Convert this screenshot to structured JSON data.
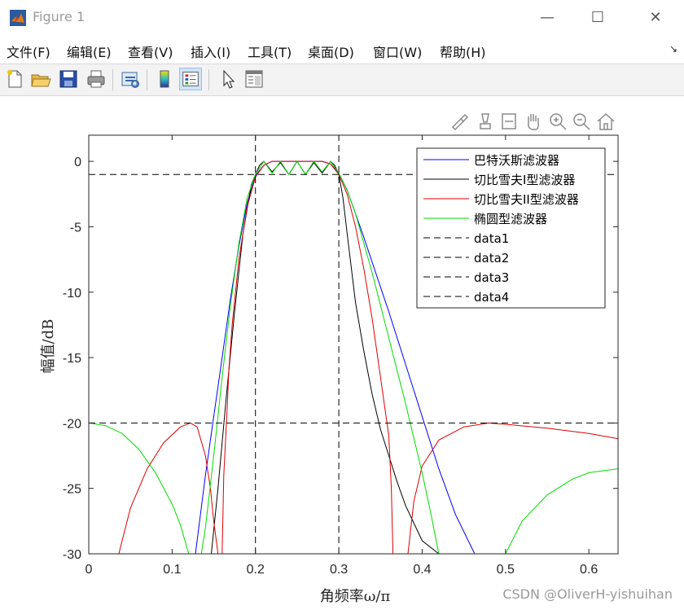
{
  "window": {
    "title": "Figure 1",
    "minimize": "—",
    "maximize": "☐",
    "close": "✕"
  },
  "menu": [
    "文件(F)",
    "编辑(E)",
    "查看(V)",
    "插入(I)",
    "工具(T)",
    "桌面(D)",
    "窗口(W)",
    "帮助(H)"
  ],
  "toolbar": {
    "buttons": [
      "new-figure-icon",
      "open-file-icon",
      "save-icon",
      "print-icon",
      "link-plot-icon",
      "colorbar-icon",
      "legend-icon",
      "pointer-icon",
      "property-inspector-icon"
    ]
  },
  "axes_toolbar": [
    "brush-icon",
    "data-tips-icon",
    "restore-view-icon",
    "pan-icon",
    "zoom-in-icon",
    "zoom-out-icon",
    "home-icon"
  ],
  "watermark": "CSDN @OliverH-yishuihan",
  "chart_data": {
    "type": "line",
    "title": "",
    "xlabel": "角频率ω/π",
    "ylabel": "幅值/dB",
    "xlim": [
      0,
      0.635
    ],
    "ylim": [
      -30,
      2
    ],
    "xticks": [
      0,
      0.1,
      0.2,
      0.3,
      0.4,
      0.5,
      0.6
    ],
    "xtick_labels": [
      "0",
      "0.1",
      "0.2",
      "0.3",
      "0.4",
      "0.5",
      "0.6"
    ],
    "yticks": [
      0,
      -5,
      -10,
      -15,
      -20,
      -25,
      -30
    ],
    "ytick_labels": [
      "0",
      "-5",
      "-10",
      "-15",
      "-20",
      "-25",
      "-30"
    ],
    "grid": false,
    "legend_position": "top-right",
    "series": [
      {
        "name": "巴特沃斯滤波器",
        "color": "#0000ff",
        "style": "solid",
        "x": [
          0.128,
          0.14,
          0.15,
          0.16,
          0.17,
          0.18,
          0.19,
          0.2,
          0.21,
          0.22,
          0.25,
          0.28,
          0.29,
          0.3,
          0.31,
          0.32,
          0.33,
          0.34,
          0.36,
          0.38,
          0.4,
          0.42,
          0.44,
          0.463
        ],
        "y": [
          -30,
          -24,
          -19.5,
          -15,
          -10.5,
          -6.5,
          -3.2,
          -1.1,
          -0.3,
          0,
          0,
          0,
          -0.2,
          -0.9,
          -2.2,
          -4,
          -5.8,
          -7.7,
          -11.5,
          -15.5,
          -19.5,
          -23.5,
          -27,
          -30
        ]
      },
      {
        "name": "切比雪夫I型滤波器",
        "color": "#000000",
        "style": "solid",
        "x": [
          0.147,
          0.155,
          0.165,
          0.175,
          0.185,
          0.195,
          0.2,
          0.205,
          0.21,
          0.22,
          0.23,
          0.24,
          0.25,
          0.26,
          0.27,
          0.28,
          0.29,
          0.295,
          0.3,
          0.305,
          0.31,
          0.32,
          0.33,
          0.34,
          0.35,
          0.36,
          0.37,
          0.38,
          0.4,
          0.42
        ],
        "y": [
          -30,
          -25,
          -18,
          -11.5,
          -5.5,
          -1.8,
          -1,
          -0.3,
          0,
          -0.8,
          -0.1,
          -1,
          0,
          -1,
          -0.1,
          -0.9,
          0,
          -0.3,
          -1,
          -2.8,
          -5.5,
          -10.8,
          -14.5,
          -17.8,
          -20.5,
          -22.5,
          -24.5,
          -26.3,
          -29,
          -30
        ]
      },
      {
        "name": "切比雪夫II型滤波器",
        "color": "#dd0000",
        "style": "solid",
        "x": [
          0.036,
          0.05,
          0.07,
          0.09,
          0.11,
          0.122,
          0.13,
          0.14,
          0.146,
          0.15,
          0.155,
          0.16,
          0.162,
          0.166,
          0.168,
          0.172,
          0.18,
          0.19,
          0.2,
          0.21,
          0.22,
          0.25,
          0.28,
          0.29,
          0.3,
          0.31,
          0.32,
          0.33,
          0.34,
          0.35,
          0.36,
          0.363,
          0.365,
          0.368,
          0.373,
          0.383,
          0.39,
          0.4,
          0.42,
          0.45,
          0.48,
          0.5,
          0.55,
          0.6,
          0.635
        ],
        "y": [
          -30,
          -26.5,
          -23.5,
          -21.5,
          -20.3,
          -20,
          -20.3,
          -22.5,
          -25,
          -27.5,
          -30,
          -30,
          -24,
          -19,
          -16,
          -12.5,
          -7.5,
          -3.5,
          -1.2,
          -0.3,
          0,
          0,
          0,
          -0.2,
          -1,
          -2.5,
          -5,
          -8.2,
          -12,
          -16.5,
          -21,
          -25,
          -30,
          -30,
          -30,
          -30,
          -26,
          -23.3,
          -21.3,
          -20.3,
          -20,
          -20.1,
          -20.4,
          -20.8,
          -21.2
        ]
      },
      {
        "name": "椭圆型滤波器",
        "color": "#00dd00",
        "style": "solid",
        "x": [
          0,
          0.02,
          0.04,
          0.06,
          0.08,
          0.1,
          0.11,
          0.12,
          0.125,
          0.13,
          0.135,
          0.14,
          0.15,
          0.16,
          0.17,
          0.18,
          0.19,
          0.2,
          0.21,
          0.22,
          0.23,
          0.24,
          0.25,
          0.26,
          0.27,
          0.28,
          0.29,
          0.3,
          0.31,
          0.32,
          0.34,
          0.36,
          0.38,
          0.4,
          0.41,
          0.42,
          0.425,
          0.5,
          0.52,
          0.55,
          0.58,
          0.6,
          0.635
        ],
        "y": [
          -20,
          -20.2,
          -20.8,
          -22,
          -23.8,
          -26.2,
          -27.8,
          -30,
          -30,
          -30,
          -30,
          -28,
          -22.5,
          -16.5,
          -11,
          -6.3,
          -2.8,
          -1,
          0,
          -0.9,
          0,
          -1,
          0,
          -1,
          0,
          -0.8,
          0,
          -0.9,
          -2.2,
          -4,
          -8.5,
          -13.5,
          -18.5,
          -23.8,
          -26.8,
          -30,
          -30,
          -30,
          -27.5,
          -25.5,
          -24.3,
          -23.8,
          -23.5
        ]
      },
      {
        "name": "data1",
        "color": "#000000",
        "style": "dashed",
        "x": [
          0,
          0.635
        ],
        "y": [
          -1,
          -1
        ]
      },
      {
        "name": "data2",
        "color": "#000000",
        "style": "dashed",
        "x": [
          0,
          0.635
        ],
        "y": [
          -20,
          -20
        ]
      },
      {
        "name": "data3",
        "color": "#000000",
        "style": "dashed",
        "x": [
          0.2,
          0.2
        ],
        "y": [
          -30,
          2
        ]
      },
      {
        "name": "data4",
        "color": "#000000",
        "style": "dashed",
        "x": [
          0.3,
          0.3
        ],
        "y": [
          -30,
          2
        ]
      }
    ]
  }
}
